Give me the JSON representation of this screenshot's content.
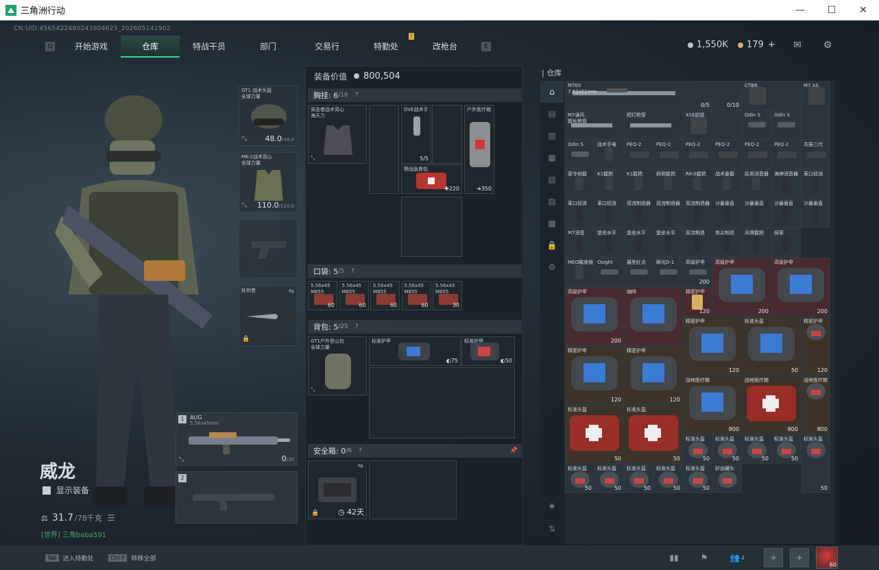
{
  "window": {
    "title": "三角洲行动",
    "minimize": "—",
    "maximize": "☐",
    "close": "✕"
  },
  "uid": "CN:UID:4565422480243804625_202605141902",
  "nav": {
    "left_key": "Q",
    "right_key": "E",
    "tabs": [
      "开始游戏",
      "仓库",
      "特战干员",
      "部门",
      "交易行",
      "特勤处",
      "改枪台"
    ],
    "active_index": 1,
    "badge": "!"
  },
  "currency": {
    "silver": "1,550K",
    "gold": "179",
    "gold_plus": "+"
  },
  "operator": {
    "name": "威龙",
    "show_gear": "显示装备",
    "weight": "31.7",
    "weight_cap": "/78千克",
    "chat_prefix": "[世界]",
    "chat_user": "三角baba591"
  },
  "gear": {
    "helmet": {
      "label": "GT1 战术头盔\n全球力量",
      "durability": "48.0",
      "max": "/48.0"
    },
    "armor": {
      "label": "MK-2战术背心\n全球力量",
      "durability": "110.0",
      "max": "/110.0"
    },
    "melee": {
      "label": "处刑者"
    }
  },
  "weapons": {
    "slot1": {
      "num": "1",
      "name": "AUG",
      "ammo_type": "5.56x45mm",
      "ammo": "0",
      "ammo_max": "/30"
    },
    "slot2": {
      "num": "2"
    }
  },
  "loadout": {
    "value_label": "装备价值",
    "value": "800,504",
    "rig": {
      "title": "胸挂:",
      "count": "6",
      "cap": "/16",
      "q": "?",
      "item": "突击者战术背心\n海天力",
      "dve": "DVE战术手",
      "dve_cnt": "5/5",
      "firstaid": "野战急救包",
      "firstaid_cnt": "220",
      "outdoor": "户外医疗箱",
      "outdoor_cnt": "350"
    },
    "pocket": {
      "title": "口袋:",
      "count": "5",
      "cap": "/5",
      "q": "?",
      "items": [
        {
          "label": "5.56x45\nM855",
          "cnt": "60"
        },
        {
          "label": "5.56x45\nM855",
          "cnt": "60"
        },
        {
          "label": "5.56x45\nM855",
          "cnt": "60"
        },
        {
          "label": "5.56x45\nM855",
          "cnt": "60"
        },
        {
          "label": "5.56x45\nM855",
          "cnt": "30"
        }
      ]
    },
    "backpack": {
      "title": "背包:",
      "count": "5",
      "cap": "/25",
      "q": "?",
      "item": "GT1户外登山包\n全球力量",
      "armor1": "标准护甲",
      "armor1_cnt": "75",
      "armor2": "标准护甲",
      "armor2_cnt": "50"
    },
    "safe": {
      "title": "安全箱:",
      "count": "0",
      "cap": "/6",
      "q": "?",
      "days": "42天"
    }
  },
  "warehouse": {
    "title": "仓库",
    "items": [
      {
        "label": "M700\n7.62x51mm",
        "cnt": ""
      },
      {
        "label": "",
        "cnt": "0/5"
      },
      {
        "label": "",
        "cnt": "0/10"
      },
      {
        "label": "CTBR",
        "cnt": ""
      },
      {
        "label": "M7 AS",
        "cnt": ""
      },
      {
        "label": "M7通风\n超长枪管",
        "cnt": ""
      },
      {
        "label": "短灯枪管",
        "cnt": ""
      },
      {
        "label": "416前锁",
        "cnt": ""
      },
      {
        "label": "Odin S",
        "cnt": ""
      },
      {
        "label": "Odin S",
        "cnt": ""
      },
      {
        "label": "Odin S",
        "cnt": ""
      },
      {
        "label": "战术手电",
        "cnt": ""
      },
      {
        "label": "PEQ-2",
        "cnt": ""
      },
      {
        "label": "PEQ-2",
        "cnt": ""
      },
      {
        "label": "PEQ-2",
        "cnt": ""
      },
      {
        "label": "PEQ-2",
        "cnt": ""
      },
      {
        "label": "PEQ-2",
        "cnt": ""
      },
      {
        "label": "PEQ-2",
        "cnt": ""
      },
      {
        "label": "共振三代",
        "cnt": ""
      },
      {
        "label": "密令斜握",
        "cnt": ""
      },
      {
        "label": "K1握把",
        "cnt": ""
      },
      {
        "label": "K1握把",
        "cnt": ""
      },
      {
        "label": "斜侧握把",
        "cnt": ""
      },
      {
        "label": "RK-0握把",
        "cnt": ""
      },
      {
        "label": "战术垂握",
        "cnt": ""
      },
      {
        "label": "民用消音器",
        "cnt": ""
      },
      {
        "label": "海神消音器",
        "cnt": ""
      },
      {
        "label": "革口径消",
        "cnt": ""
      },
      {
        "label": "革口径消",
        "cnt": ""
      },
      {
        "label": "革口径消",
        "cnt": ""
      },
      {
        "label": "双流制退器",
        "cnt": ""
      },
      {
        "label": "双流制退器",
        "cnt": ""
      },
      {
        "label": "双流制退器",
        "cnt": ""
      },
      {
        "label": "沙暴垂直",
        "cnt": ""
      },
      {
        "label": "沙暴垂直",
        "cnt": ""
      },
      {
        "label": "沙暴垂直",
        "cnt": ""
      },
      {
        "label": "沙暴垂直",
        "cnt": ""
      },
      {
        "label": "M7消音",
        "cnt": ""
      },
      {
        "label": "堡垒水平",
        "cnt": ""
      },
      {
        "label": "堡垒水平",
        "cnt": ""
      },
      {
        "label": "堡垒水平",
        "cnt": ""
      },
      {
        "label": "双流制退",
        "cnt": ""
      },
      {
        "label": "铁尖制退",
        "cnt": ""
      },
      {
        "label": "兵牌握把",
        "cnt": ""
      },
      {
        "label": "探索",
        "cnt": ""
      },
      {
        "label": "MEO瞄准镜",
        "cnt": ""
      },
      {
        "label": "Osight",
        "cnt": ""
      },
      {
        "label": "展型红点",
        "cnt": ""
      },
      {
        "label": "瞬光D-1",
        "cnt": ""
      },
      {
        "label": "高级护甲",
        "cnt": "200"
      },
      {
        "label": "高级护甲",
        "cnt": "200"
      },
      {
        "label": "高级护甲",
        "cnt": "200"
      },
      {
        "label": "高级护甲",
        "cnt": "200"
      },
      {
        "label": "咖啡",
        "cnt": ""
      },
      {
        "label": "精密护甲",
        "cnt": "120"
      },
      {
        "label": "精密护甲",
        "cnt": "120"
      },
      {
        "label": "标准头盔",
        "cnt": "50"
      },
      {
        "label": "精密护甲",
        "cnt": "120"
      },
      {
        "label": "精密护甲",
        "cnt": "120"
      },
      {
        "label": "精密护甲",
        "cnt": "120"
      },
      {
        "label": "战地医疗箱",
        "cnt": "800"
      },
      {
        "label": "标准头盔",
        "cnt": "50"
      },
      {
        "label": "战地医疗箱",
        "cnt": "800"
      },
      {
        "label": "战地医疗箱",
        "cnt": "800"
      },
      {
        "label": "标准头盔",
        "cnt": "50"
      },
      {
        "label": "标准头盔",
        "cnt": "50"
      },
      {
        "label": "标准头盔",
        "cnt": "50"
      },
      {
        "label": "标准头盔",
        "cnt": "50"
      },
      {
        "label": "标准头盔",
        "cnt": "50"
      },
      {
        "label": "标准头盔",
        "cnt": "50"
      },
      {
        "label": "标准头盔",
        "cnt": "50"
      },
      {
        "label": "标准头盔",
        "cnt": "50"
      },
      {
        "label": "标准头盔",
        "cnt": "50"
      },
      {
        "label": "标准头盔",
        "cnt": "50"
      },
      {
        "label": "标准头盔",
        "cnt": "50"
      },
      {
        "label": "好运罐头",
        "cnt": ""
      }
    ]
  },
  "bottom": {
    "hint1_key": "Tab",
    "hint1": "进入特勤处",
    "hint2_key": "Ctrl F",
    "hint2": "转移全部",
    "squad": "4",
    "level": "60"
  }
}
